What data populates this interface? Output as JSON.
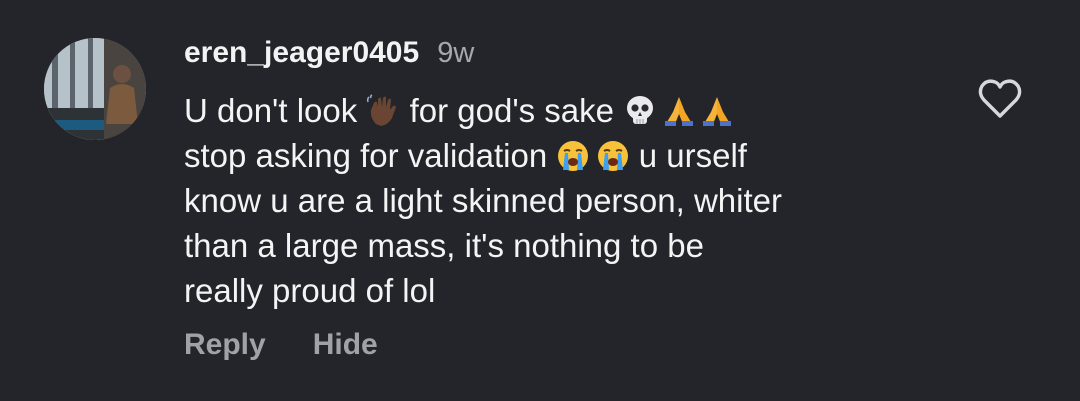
{
  "comment": {
    "username": "eren_jeager0405",
    "timestamp": "9w",
    "lines": [
      {
        "pre": "U don't look",
        "mid": "for god's sake",
        "post": ""
      },
      {
        "pre": "stop asking for validation",
        "post": "u urself"
      },
      {
        "text": "know u are a light skinned person, whiter"
      },
      {
        "text": "than a large mass, it's nothing to be"
      },
      {
        "text": "really proud of lol"
      }
    ],
    "emojis": [
      "waving-hand-dark-skin",
      "skull",
      "folded-hands",
      "folded-hands",
      "loudly-crying-face",
      "loudly-crying-face"
    ],
    "actions": {
      "reply": "Reply",
      "hide": "Hide"
    },
    "like_icon": "heart-outline-icon"
  },
  "colors": {
    "background": "#23252b",
    "text": "#f4f4f4",
    "muted": "#a7a8ad"
  }
}
